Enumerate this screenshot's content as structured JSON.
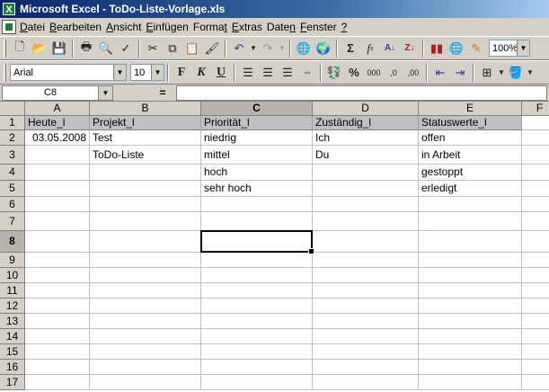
{
  "window": {
    "title": "Microsoft Excel - ToDo-Liste-Vorlage.xls"
  },
  "menu": [
    {
      "u": "D",
      "rest": "atei"
    },
    {
      "u": "B",
      "rest": "earbeiten"
    },
    {
      "u": "A",
      "rest": "nsicht"
    },
    {
      "u": "E",
      "rest": "infügen"
    },
    {
      "u": "",
      "pre": "Forma",
      "rest": "t"
    },
    {
      "u": "",
      "pre": "E",
      "rest": "xtras"
    },
    {
      "u": "",
      "pre": "Date",
      "rest": "n"
    },
    {
      "u": "",
      "pre": "F",
      "rest": "enster"
    },
    {
      "u": "",
      "pre": "",
      "rest": "?"
    }
  ],
  "toolbar": {
    "zoom": "100%",
    "font": "Arial",
    "font_size": "10",
    "bold_label": "F",
    "italic_label": "K",
    "underline_label": "U",
    "sum_label": "Σ",
    "fx_label": "f",
    "fx_sub": "x",
    "percent_label": "%",
    "thousands_label": "000"
  },
  "formula_bar": {
    "name_box": "C8",
    "equals": "=",
    "value": ""
  },
  "grid": {
    "columns": [
      "A",
      "B",
      "C",
      "D",
      "E",
      "F"
    ],
    "rows": [
      "1",
      "2",
      "3",
      "4",
      "5",
      "6",
      "7",
      "8",
      "9",
      "10",
      "11",
      "12",
      "13",
      "14",
      "15",
      "16",
      "17"
    ],
    "active_cell": "C8",
    "header_row": [
      "Heute_l",
      "Projekt_l",
      "Priorität_l",
      "Zuständig_l",
      "Statuswerte_l"
    ],
    "data": [
      [
        "03.05.2008",
        "Test",
        "niedrig",
        "Ich",
        "offen"
      ],
      [
        "",
        "ToDo-Liste",
        "mittel",
        "Du",
        "in Arbeit"
      ],
      [
        "",
        "",
        "hoch",
        "",
        "gestoppt"
      ],
      [
        "",
        "",
        "sehr hoch",
        "",
        "erledigt"
      ]
    ]
  }
}
